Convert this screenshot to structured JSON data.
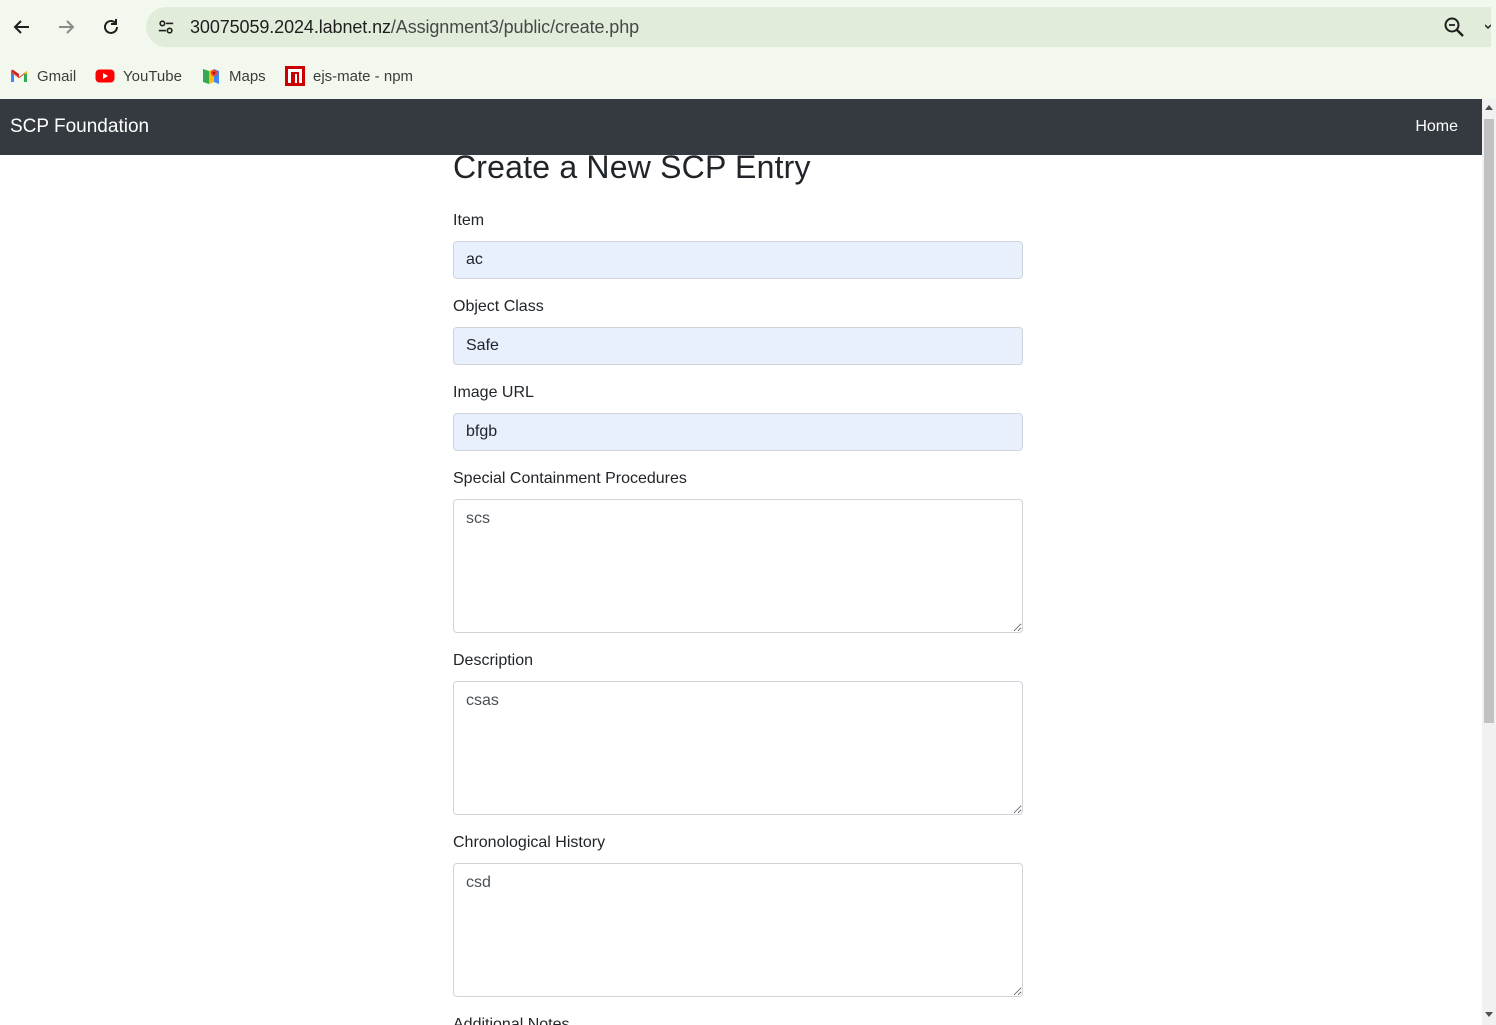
{
  "browser": {
    "url_host": "30075059.2024.labnet.nz",
    "url_path": "/Assignment3/public/create.php",
    "bookmarks": [
      {
        "label": "Gmail",
        "icon": "gmail-icon"
      },
      {
        "label": "YouTube",
        "icon": "youtube-icon"
      },
      {
        "label": "Maps",
        "icon": "maps-icon"
      },
      {
        "label": "ejs-mate - npm",
        "icon": "npm-icon"
      }
    ]
  },
  "navbar": {
    "brand": "SCP Foundation",
    "home_link": "Home"
  },
  "form": {
    "title": "Create a New SCP Entry",
    "item_label": "Item",
    "item_value": "ac",
    "object_class_label": "Object Class",
    "object_class_value": "Safe",
    "image_url_label": "Image URL",
    "image_url_value": "bfgb",
    "containment_label": "Special Containment Procedures",
    "containment_value": "scs",
    "description_label": "Description",
    "description_value": "csas",
    "history_label": "Chronological History",
    "history_value": "csd",
    "notes_label": "Additional Notes"
  },
  "colors": {
    "navbar_bg": "#343a40",
    "autofill_bg": "#e8f0fe",
    "chrome_bg": "#f3f8ee"
  }
}
